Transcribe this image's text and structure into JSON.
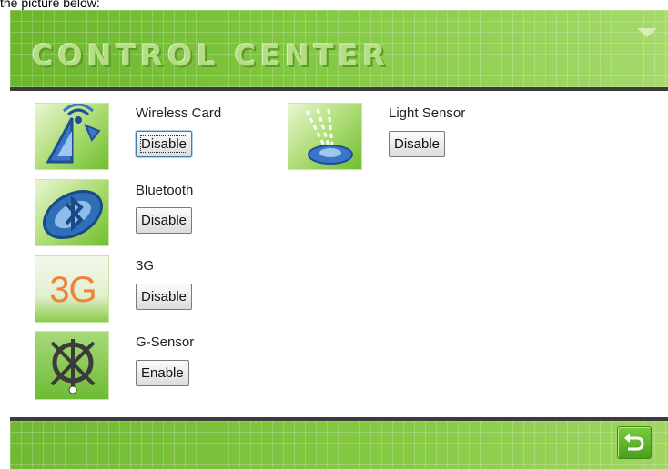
{
  "caption": "the picture below:",
  "header": {
    "title": "CONTROL CENTER"
  },
  "devices": [
    {
      "label": "Wireless Card",
      "button": "Disable",
      "icon": "wireless-antenna-icon"
    },
    {
      "label": "Bluetooth",
      "button": "Disable",
      "icon": "bluetooth-icon"
    },
    {
      "label": "3G",
      "button": "Disable",
      "icon": "3g-icon",
      "icon_text": "3G"
    },
    {
      "label": "G-Sensor",
      "button": "Enable",
      "icon": "g-sensor-icon"
    },
    {
      "label": "Light Sensor",
      "button": "Disable",
      "icon": "light-sensor-icon"
    }
  ],
  "colors": {
    "accent_green": "#7cc13a",
    "divider": "#3c3c3c",
    "icon_3g": "#f0823c"
  }
}
